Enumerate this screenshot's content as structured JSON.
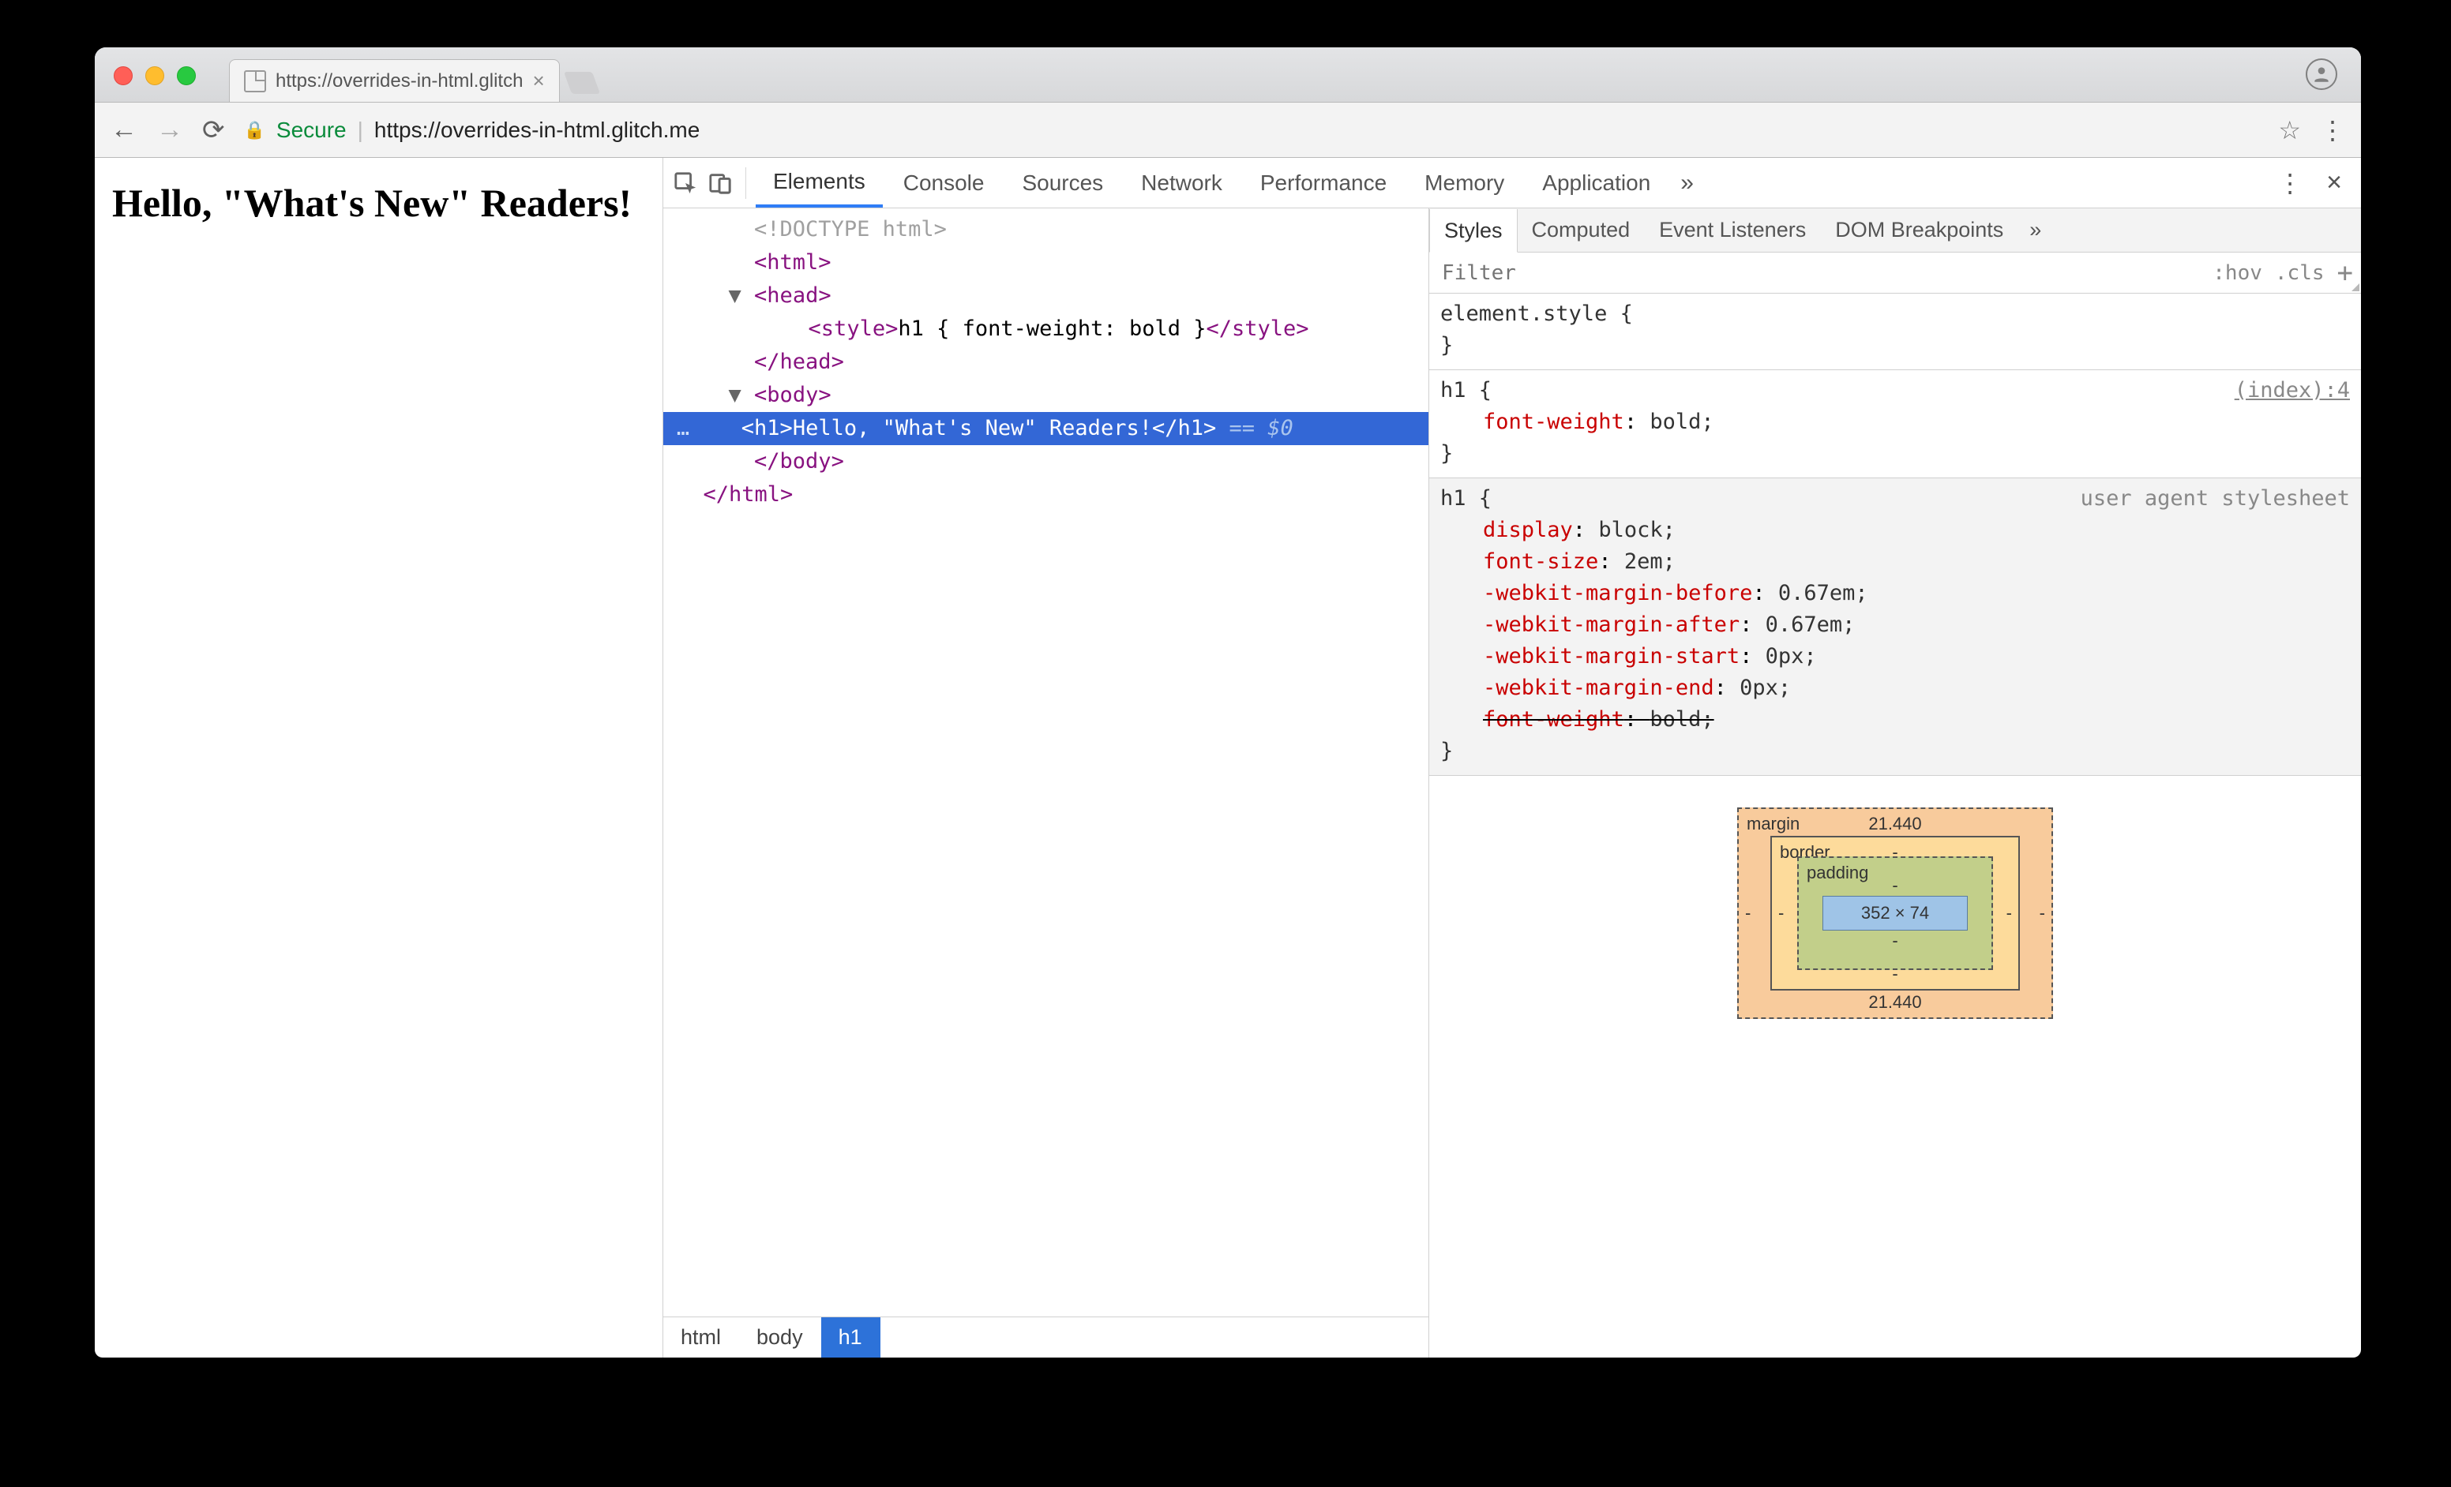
{
  "browser": {
    "tab_title": "https://overrides-in-html.glitch",
    "secure_label": "Secure",
    "url_host": "https://overrides-in-html.glitch.me",
    "url_path": ""
  },
  "page": {
    "heading": "Hello, \"What's New\" Readers!"
  },
  "devtools": {
    "tabs": [
      "Elements",
      "Console",
      "Sources",
      "Network",
      "Performance",
      "Memory",
      "Application"
    ],
    "selected_tab": "Elements",
    "overflow": "»",
    "elements": {
      "lines": [
        {
          "indent": 0,
          "type": "doctype",
          "text": "<!DOCTYPE html>"
        },
        {
          "indent": 0,
          "type": "tag_open",
          "text": "<html>"
        },
        {
          "indent": 0,
          "type": "collapsible_open",
          "caret": "▼",
          "text": "<head>"
        },
        {
          "indent": 1,
          "type": "inline",
          "open": "<style>",
          "inner": "h1 { font-weight: bold }",
          "close": "</style>"
        },
        {
          "indent": 0,
          "type": "tag_close",
          "text": "</head>"
        },
        {
          "indent": 0,
          "type": "collapsible_open",
          "caret": "▼",
          "text": "<body>"
        },
        {
          "indent": 1,
          "type": "selected",
          "gutter": "…",
          "open": "<h1>",
          "inner": "Hello, \"What's New\" Readers!",
          "close": "</h1>",
          "hint": " == $0"
        },
        {
          "indent": 0,
          "type": "tag_close",
          "text": "</body>"
        },
        {
          "indent": -1,
          "type": "tag_close",
          "text": "</html>"
        }
      ],
      "breadcrumbs": [
        "html",
        "body",
        "h1"
      ],
      "breadcrumb_selected": "h1"
    },
    "styles": {
      "sub_tabs": [
        "Styles",
        "Computed",
        "Event Listeners",
        "DOM Breakpoints"
      ],
      "sub_selected": "Styles",
      "overflow": "»",
      "filter_placeholder": "Filter",
      "hov": ":hov",
      "cls": ".cls",
      "rules": [
        {
          "selector": "element.style",
          "source": "",
          "decls": [],
          "ua": false
        },
        {
          "selector": "h1",
          "source": "(index):4",
          "source_link": true,
          "decls": [
            {
              "prop": "font-weight",
              "val": "bold;"
            }
          ],
          "ua": false
        },
        {
          "selector": "h1",
          "source": "user agent stylesheet",
          "decls": [
            {
              "prop": "display",
              "val": "block;"
            },
            {
              "prop": "font-size",
              "val": "2em;"
            },
            {
              "prop": "-webkit-margin-before",
              "val": "0.67em;"
            },
            {
              "prop": "-webkit-margin-after",
              "val": "0.67em;"
            },
            {
              "prop": "-webkit-margin-start",
              "val": "0px;"
            },
            {
              "prop": "-webkit-margin-end",
              "val": "0px;"
            },
            {
              "prop": "font-weight",
              "val": "bold;",
              "strike": true
            }
          ],
          "ua": true
        }
      ],
      "box_model": {
        "margin_label": "margin",
        "margin_top": "21.440",
        "margin_bottom": "21.440",
        "margin_left": "-",
        "margin_right": "-",
        "border_label": "border",
        "border_val": "-",
        "padding_label": "padding",
        "padding_val": "-",
        "content": "352 × 74"
      }
    }
  }
}
